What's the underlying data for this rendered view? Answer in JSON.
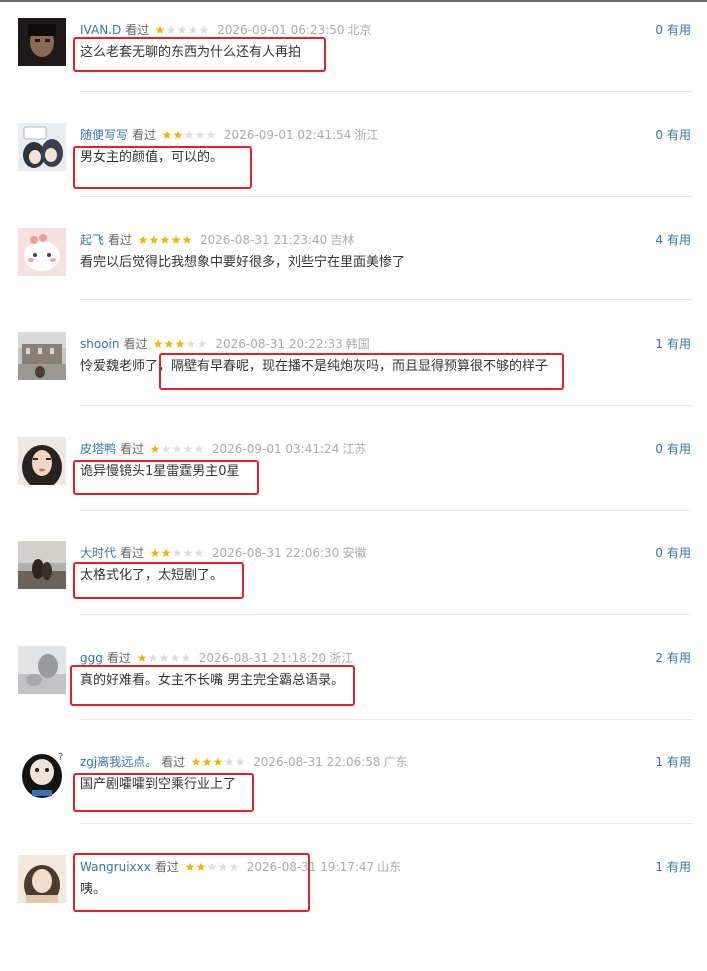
{
  "vote_label": "有用",
  "watched_label": "看过",
  "colors": {
    "username": "#3377aa",
    "star_on": "#f5b400",
    "star_off": "#dddddd",
    "highlight_box": "#e0232b"
  },
  "comments": [
    {
      "user": "IVAN.D",
      "rating": 1,
      "time": "2026-09-01 06:23:50",
      "region": "北京",
      "votes": "0",
      "text": "这么老套无聊的东西为什么还有人再拍",
      "avatar": "dark-portrait-avatar",
      "highlighted": true
    },
    {
      "user": "随便写写",
      "rating": 2,
      "time": "2026-09-01 02:41:54",
      "region": "浙江",
      "votes": "0",
      "text": "男女主的颜值，可以的。",
      "avatar": "anime-couple-avatar",
      "highlighted": true
    },
    {
      "user": "起飞",
      "rating": 5,
      "time": "2026-08-31 21:23:40",
      "region": "吉林",
      "votes": "4",
      "text": "看完以后觉得比我想象中要好很多，刘些宁在里面美惨了",
      "avatar": "pink-cartoon-avatar",
      "highlighted": false
    },
    {
      "user": "shooin",
      "rating": 3,
      "time": "2026-08-31 20:22:33",
      "region": "韩国",
      "votes": "1",
      "text": "怜爱魏老师了，隔壁有早春呢，现在播不是纯炮灰吗，而且显得预算很不够的样子",
      "avatar": "building-photo-avatar",
      "highlighted": true
    },
    {
      "user": "皮塔鸭",
      "rating": 1,
      "time": "2026-09-01 03:41:24",
      "region": "江苏",
      "votes": "0",
      "text": "诡异慢镜头1星雷霆男主0星",
      "avatar": "girl-portrait-avatar",
      "highlighted": true
    },
    {
      "user": "大时代",
      "rating": 2,
      "time": "2026-08-31 22:06:30",
      "region": "安徽",
      "votes": "0",
      "text": "太格式化了，太短剧了。",
      "avatar": "silhouette-photo-avatar",
      "highlighted": true
    },
    {
      "user": "ggg",
      "rating": 1,
      "time": "2026-08-31 21:18:20",
      "region": "浙江",
      "votes": "2",
      "text": "真的好难看。女主不长嘴 男主完全霸总语录。",
      "avatar": "snowy-photo-avatar",
      "highlighted": true
    },
    {
      "user": "zgj离我远点。",
      "rating": 3,
      "time": "2026-08-31 22:06:58",
      "region": "广东",
      "votes": "1",
      "text": "国产剧嚯嚯到空乘行业上了",
      "avatar": "penguin-meme-avatar",
      "highlighted": true
    },
    {
      "user": "Wangruixxx",
      "rating": 2,
      "time": "2026-08-31 19:17:47",
      "region": "山东",
      "votes": "1",
      "text": "咦。",
      "avatar": "selfie-avatar",
      "highlighted": true
    }
  ]
}
